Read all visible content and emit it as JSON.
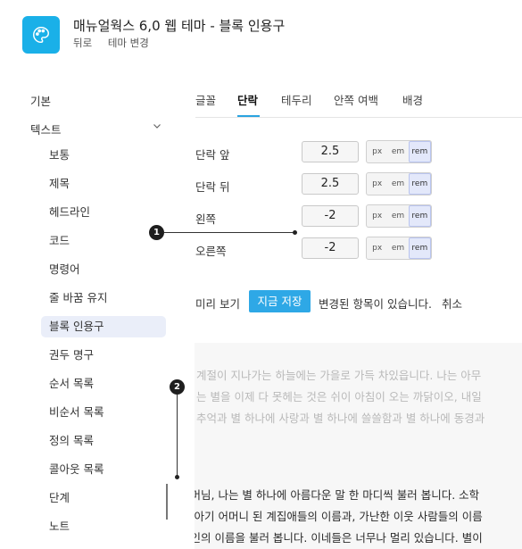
{
  "header": {
    "title": "매뉴얼웍스 6,0 웹 테마 - 블록 인용구",
    "links": [
      "뒤로",
      "테마 변경"
    ],
    "icon": "palette-icon",
    "accent": "#1ab0e8"
  },
  "sidebar": {
    "top_items": [
      "기본",
      "텍스트"
    ],
    "sub_items": [
      "보통",
      "제목",
      "헤드라인",
      "코드",
      "명령어",
      "줄 바꿈 유지",
      "블록 인용구",
      "권두 명구",
      "순서 목록",
      "비순서 목록",
      "정의 목록",
      "콜아웃 목록",
      "단계",
      "노트"
    ],
    "active": "블록 인용구"
  },
  "tabs": [
    "글꼴",
    "단락",
    "테두리",
    "안쪽 여백",
    "배경"
  ],
  "active_tab": "단락",
  "rows": [
    {
      "label": "단락 앞",
      "value": "2.5"
    },
    {
      "label": "단락 뒤",
      "value": "2.5"
    },
    {
      "label": "왼쪽",
      "value": "-2"
    },
    {
      "label": "오른쪽",
      "value": "-2"
    }
  ],
  "units": [
    "px",
    "em",
    "rem"
  ],
  "selected_unit": "rem",
  "actions": {
    "preview": "미리 보기",
    "save": "지금 저장",
    "changed": "변경된 항목이 있습니다.",
    "cancel": "취소"
  },
  "preview": {
    "faded_lines": [
      "계절이 지나가는 하늘에는 가을로 가득 차있읍니다. 나는 아무",
      "는 별을 이제 다 못헤는 것은 쉬이 아침이 오는 까닭이오, 내일",
      "추억과 별 하나에 사랑과 별 하나에 쓸쓸함과 별 하나에 동경과"
    ],
    "quote_lines": [
      "어머님, 나는 별 하나에 아름다운 말 한 마디씩 불러 봅니다. 소학",
      "써 아기 어머니 된 계집애들의 이름과, 가난한 이웃 사람들의 이름",
      "시인의 이름을 불러 봅니다. 이네들은 너무나 멀리 있습니다. 별이"
    ]
  },
  "callouts": [
    "1",
    "2"
  ]
}
